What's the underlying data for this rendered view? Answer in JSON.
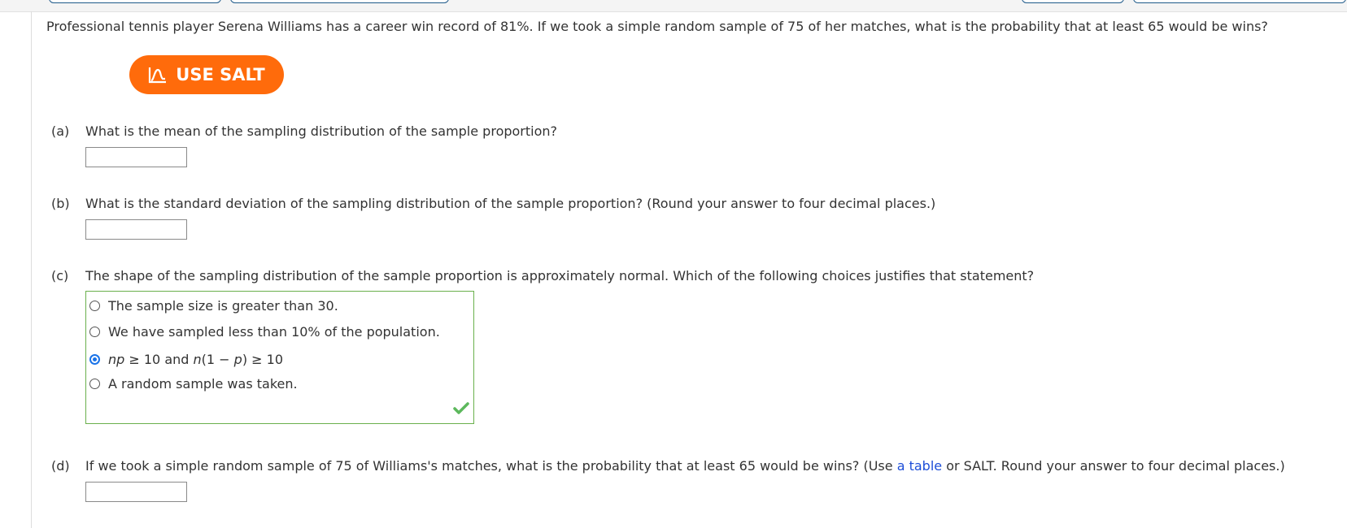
{
  "question": {
    "text": "Professional tennis player Serena Williams has a career win record of 81%. If we took a simple random sample of 75 of her matches, what is the probability that at least 65 would be wins?"
  },
  "salt_button": {
    "label": "USE SALT",
    "icon": "salt-chart-icon",
    "color": "#ff6b0b"
  },
  "parts": {
    "a": {
      "label": "(a)",
      "prompt": "What is the mean of the sampling distribution of the sample proportion?",
      "value": ""
    },
    "b": {
      "label": "(b)",
      "prompt": "What is the standard deviation of the sampling distribution of the sample proportion? (Round your answer to four decimal places.)",
      "value": ""
    },
    "c": {
      "label": "(c)",
      "prompt": "The shape of the sampling distribution of the sample proportion is approximately normal. Which of the following choices justifies that statement?",
      "choices": [
        {
          "text": "The sample size is greater than 30.",
          "selected": false
        },
        {
          "text": "We have sampled less than 10% of the population.",
          "selected": false
        },
        {
          "np": "np",
          "ge1": " ≥ 10 and ",
          "n": "n",
          "open": "(1 − ",
          "p": "p",
          "close": ") ≥ 10",
          "selected": true
        },
        {
          "text": "A random sample was taken.",
          "selected": false
        }
      ],
      "status": "correct",
      "status_icon": "checkmark-icon"
    },
    "d": {
      "label": "(d)",
      "prompt_before": "If we took a simple random sample of 75 of Williams's matches, what is the probability that at least 65 would be wins? (Use ",
      "link": "a table",
      "prompt_after": " or SALT. Round your answer to four decimal places.)",
      "value": ""
    }
  },
  "colors": {
    "accent": "#ff6b0b",
    "correct_border": "#6ab04c",
    "link": "#1d4ed8",
    "radio_selected": "#1a73e8"
  }
}
